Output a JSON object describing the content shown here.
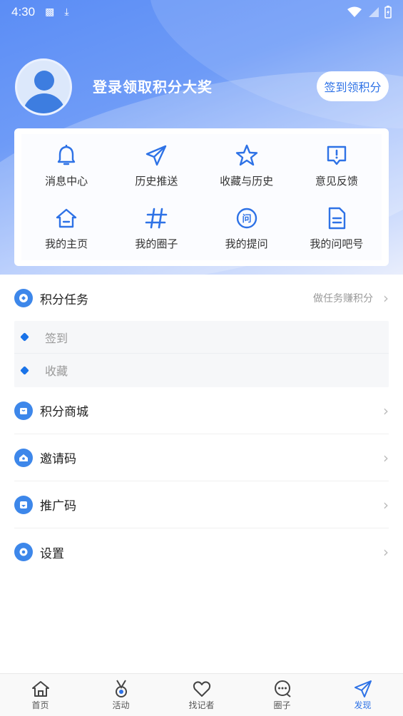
{
  "status_bar": {
    "time": "4:30"
  },
  "profile": {
    "login_text": "登录领取积分大奖",
    "signin_button": "签到领积分"
  },
  "grid": [
    {
      "label": "消息中心",
      "icon": "bell-icon"
    },
    {
      "label": "历史推送",
      "icon": "paper-plane-icon"
    },
    {
      "label": "收藏与历史",
      "icon": "star-icon"
    },
    {
      "label": "意见反馈",
      "icon": "feedback-icon"
    },
    {
      "label": "我的主页",
      "icon": "home-icon"
    },
    {
      "label": "我的圈子",
      "icon": "hash-icon"
    },
    {
      "label": "我的提问",
      "icon": "question-icon"
    },
    {
      "label": "我的问吧号",
      "icon": "document-icon"
    }
  ],
  "tasks": {
    "title": "积分任务",
    "hint": "做任务赚积分",
    "items": [
      "签到",
      "收藏"
    ]
  },
  "menu": [
    {
      "label": "积分商城",
      "icon": "mall-icon"
    },
    {
      "label": "邀请码",
      "icon": "invite-icon"
    },
    {
      "label": "推广码",
      "icon": "promo-icon"
    },
    {
      "label": "设置",
      "icon": "settings-icon"
    }
  ],
  "tabbar": [
    {
      "label": "首页",
      "icon": "home-icon"
    },
    {
      "label": "活动",
      "icon": "medal-icon"
    },
    {
      "label": "找记者",
      "icon": "heart-icon"
    },
    {
      "label": "圈子",
      "icon": "chat-icon"
    },
    {
      "label": "发现",
      "icon": "send-icon",
      "active": true
    }
  ],
  "colors": {
    "accent": "#2e72e6",
    "icon_blue": "#3d87ea"
  }
}
